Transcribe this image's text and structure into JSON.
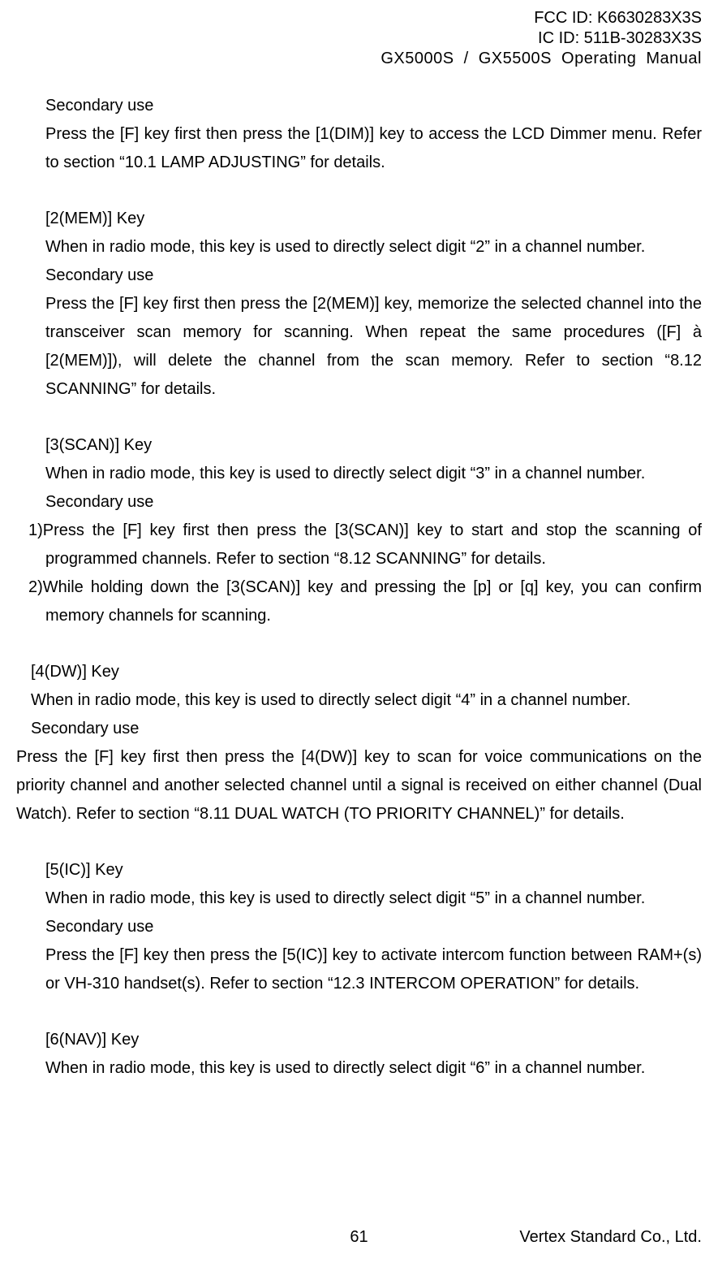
{
  "header": {
    "fcc": "FCC ID: K6630283X3S",
    "ic": "IC ID: 511B-30283X3S",
    "product": "GX5000S / GX5500S   Operating Manual"
  },
  "sections": {
    "s1": {
      "secondary": "Secondary use",
      "p1": "Press the [F] key first then press the [1(DIM)] key to access the LCD Dimmer menu. Refer to section “10.1 LAMP ADJUSTING” for details."
    },
    "s2": {
      "title": "[2(MEM)] Key",
      "p1": "When in radio mode, this key is used to directly select digit “2” in a channel number.",
      "secondary": "Secondary use",
      "p2": "Press the [F] key first then press the [2(MEM)] key, memorize the selected channel into the transceiver scan memory for scanning. When repeat the same procedures ([F] à [2(MEM)]), will delete the channel from the scan memory. Refer to section “8.12 SCANNING” for details."
    },
    "s3": {
      "title": "[3(SCAN)] Key",
      "p1": "When in radio mode, this key is used to directly select digit “3” in a channel number.",
      "secondary": "Secondary use",
      "l1": "1)Press the [F] key first then press the [3(SCAN)] key to start and stop the scanning of programmed channels. Refer to section “8.12 SCANNING” for details.",
      "l2": "2)While holding down the [3(SCAN)] key and pressing the [p] or [q] key, you can confirm memory channels for scanning."
    },
    "s4": {
      "title": "[4(DW)] Key",
      "p1": "When in radio mode, this key is used to directly select digit “4” in a channel number.",
      "secondary": "Secondary use",
      "p2": "Press the [F] key first then press the [4(DW)] key to scan for voice communications on the priority channel and another selected channel until a signal is received on either channel (Dual Watch). Refer to section “8.11 DUAL WATCH (TO PRIORITY CHANNEL)” for details."
    },
    "s5": {
      "title": "[5(IC)] Key",
      "p1": "When in radio mode, this key is used to directly select digit “5” in a channel number.",
      "secondary": "Secondary use",
      "p2": "Press the [F] key then press the [5(IC)] key to activate intercom function between RAM+(s) or VH-310 handset(s). Refer to section “12.3 INTERCOM OPERATION” for details."
    },
    "s6": {
      "title": "[6(NAV)] Key",
      "p1": "When in radio mode, this key is used to directly select digit “6” in a channel number."
    }
  },
  "footer": {
    "page": "61",
    "company": "Vertex Standard Co., Ltd."
  }
}
